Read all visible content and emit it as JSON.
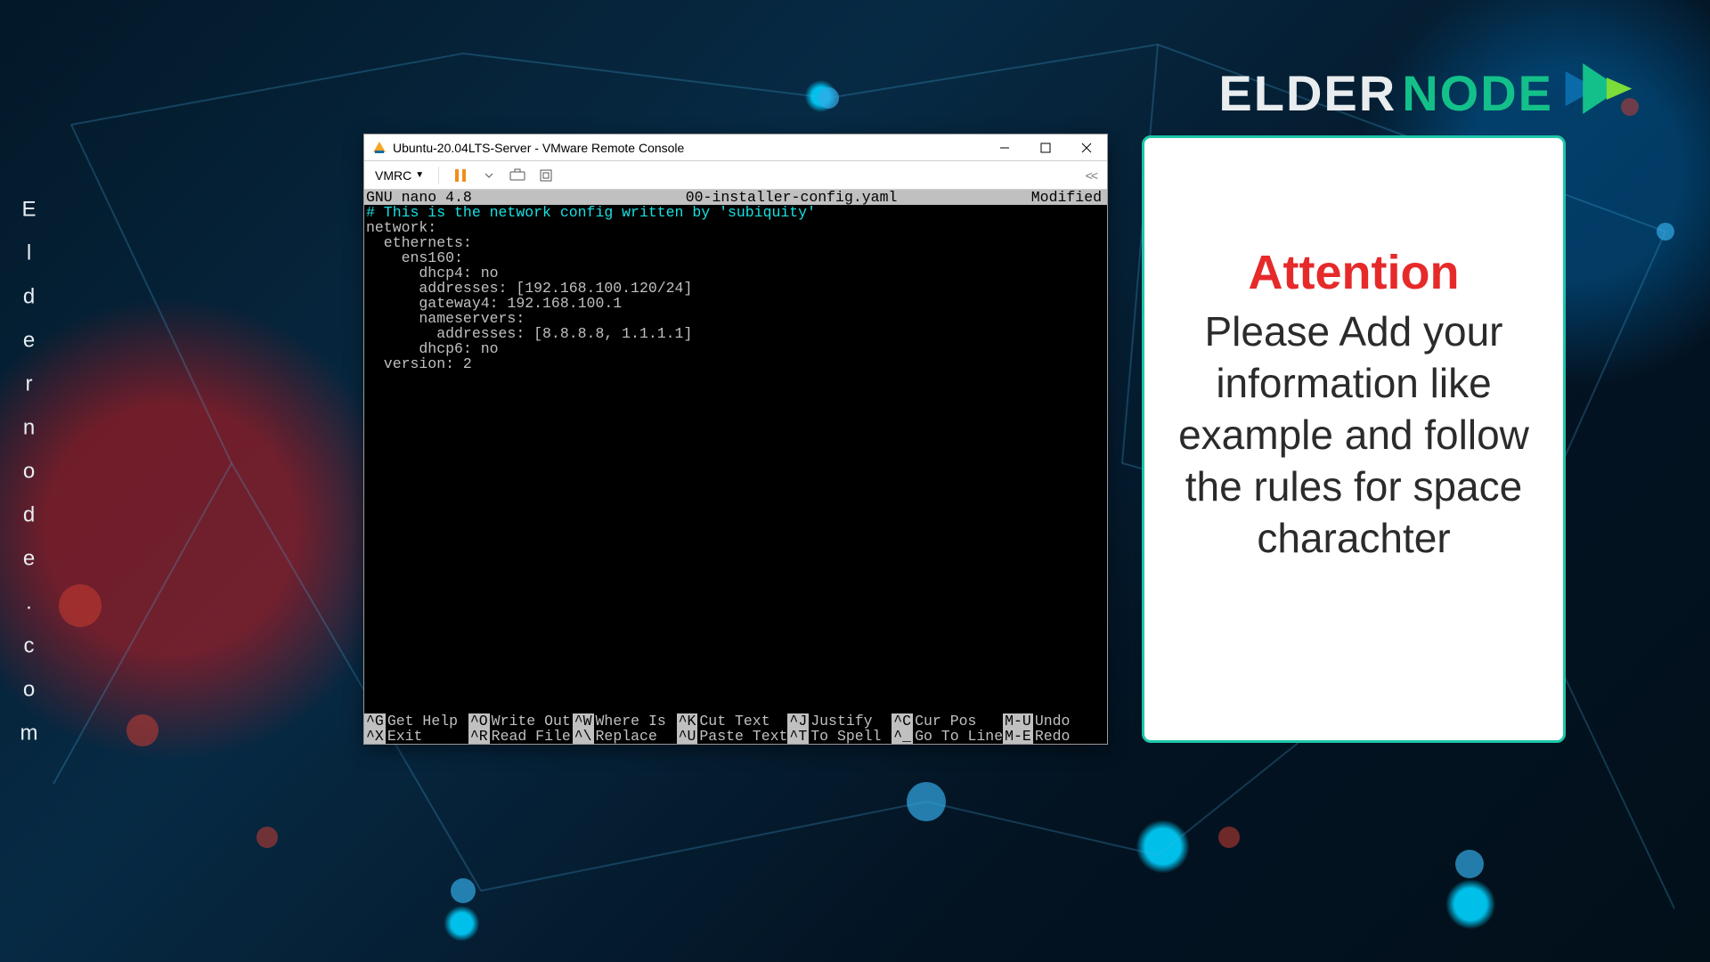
{
  "site_vertical": "Eldernode.com",
  "brand": {
    "elder": "ELDER",
    "node": "NODE"
  },
  "window": {
    "title": "Ubuntu-20.04LTS-Server - VMware Remote Console",
    "toolbar_menu": "VMRC",
    "collapse_hint": "<<"
  },
  "icons": {
    "app": "vmware-icon"
  },
  "editor": {
    "app": "GNU nano 4.8",
    "filename": "00-installer-config.yaml",
    "state": "Modified",
    "comment": "# This is the network config written by 'subiquity'",
    "lines": [
      "network:",
      "  ethernets:",
      "    ens160:",
      "      dhcp4: no",
      "      addresses: [192.168.100.120/24]",
      "      gateway4: 192.168.100.1",
      "      nameservers:",
      "        addresses: [8.8.8.8, 1.1.1.1]",
      "      dhcp6: no",
      "  version: 2"
    ],
    "hotkeys": {
      "row1": [
        {
          "k": "^G",
          "l": "Get Help"
        },
        {
          "k": "^O",
          "l": "Write Out"
        },
        {
          "k": "^W",
          "l": "Where Is"
        },
        {
          "k": "^K",
          "l": "Cut Text"
        },
        {
          "k": "^J",
          "l": "Justify"
        },
        {
          "k": "^C",
          "l": "Cur Pos"
        },
        {
          "k": "M-U",
          "l": "Undo"
        }
      ],
      "row2": [
        {
          "k": "^X",
          "l": "Exit"
        },
        {
          "k": "^R",
          "l": "Read File"
        },
        {
          "k": "^\\",
          "l": "Replace"
        },
        {
          "k": "^U",
          "l": "Paste Text"
        },
        {
          "k": "^T",
          "l": "To Spell"
        },
        {
          "k": "^_",
          "l": "Go To Line"
        },
        {
          "k": "M-E",
          "l": "Redo"
        }
      ]
    }
  },
  "card": {
    "title": "Attention",
    "body": "Please Add your information like example and follow the rules for space charachter"
  }
}
